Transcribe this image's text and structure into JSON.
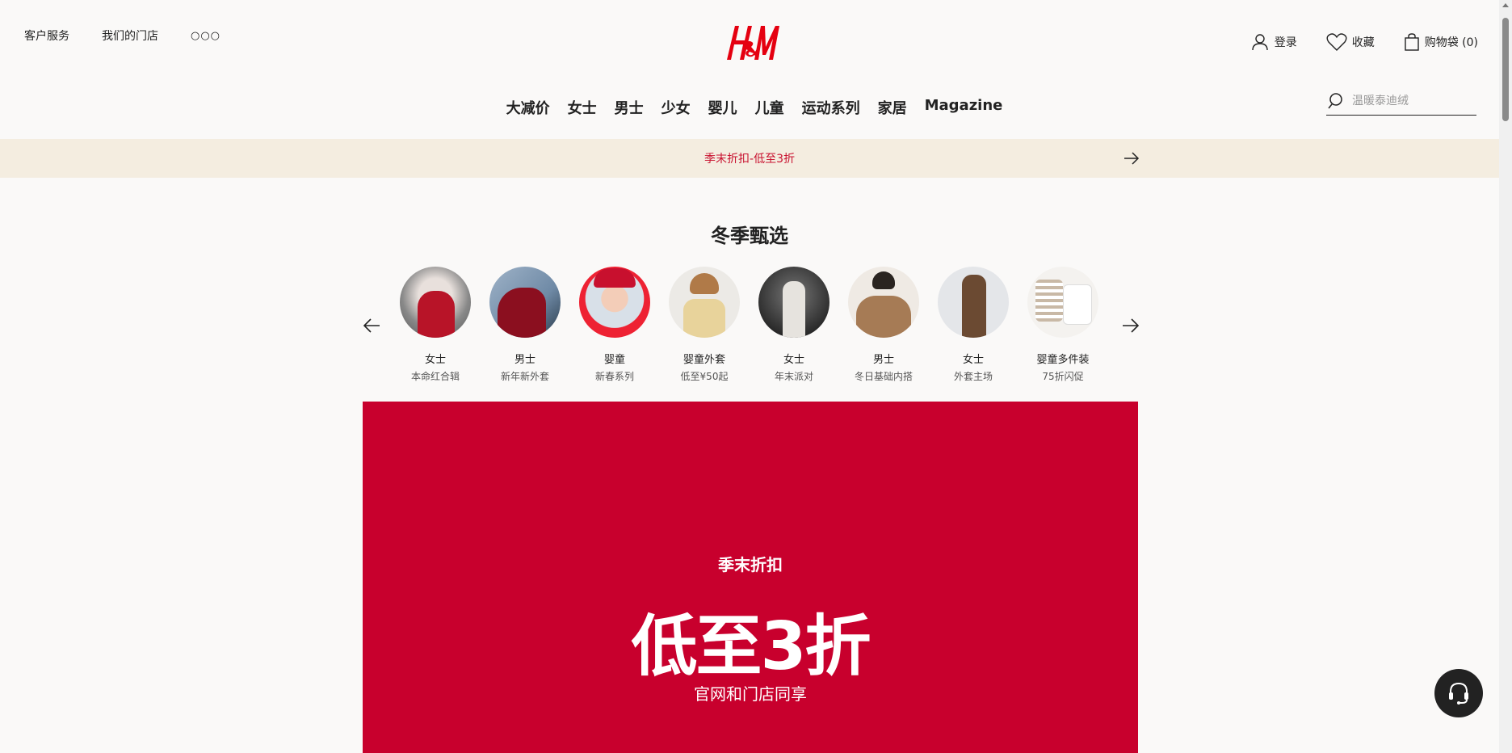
{
  "header": {
    "customer_service": "客户服务",
    "stores": "我们的门店",
    "more": "○○○",
    "login": "登录",
    "favorites": "收藏",
    "bag": "购物袋 (0)"
  },
  "nav": {
    "items": [
      "大减价",
      "女士",
      "男士",
      "少女",
      "婴儿",
      "儿童",
      "运动系列",
      "家居",
      "Magazine"
    ]
  },
  "search": {
    "placeholder": "温暖泰迪绒"
  },
  "promo_banner": {
    "text": "季末折扣-低至3折"
  },
  "winter_picks": {
    "title": "冬季甄选",
    "items": [
      {
        "category": "女士",
        "subtitle": "本命红合辑"
      },
      {
        "category": "男士",
        "subtitle": "新年新外套"
      },
      {
        "category": "婴童",
        "subtitle": "新春系列"
      },
      {
        "category": "婴童外套",
        "subtitle": "低至¥50起"
      },
      {
        "category": "女士",
        "subtitle": "年末派对"
      },
      {
        "category": "男士",
        "subtitle": "冬日基础内搭"
      },
      {
        "category": "女士",
        "subtitle": "外套主场"
      },
      {
        "category": "婴童多件装",
        "subtitle": "75折闪促"
      }
    ]
  },
  "hero": {
    "subtitle": "季末折扣",
    "headline": "低至3折",
    "note": "官网和门店同享",
    "background": "#c8002d"
  },
  "colors": {
    "brand_red": "#e50010",
    "promo_text": "#c8102e",
    "promo_bg": "#f4ede0"
  }
}
